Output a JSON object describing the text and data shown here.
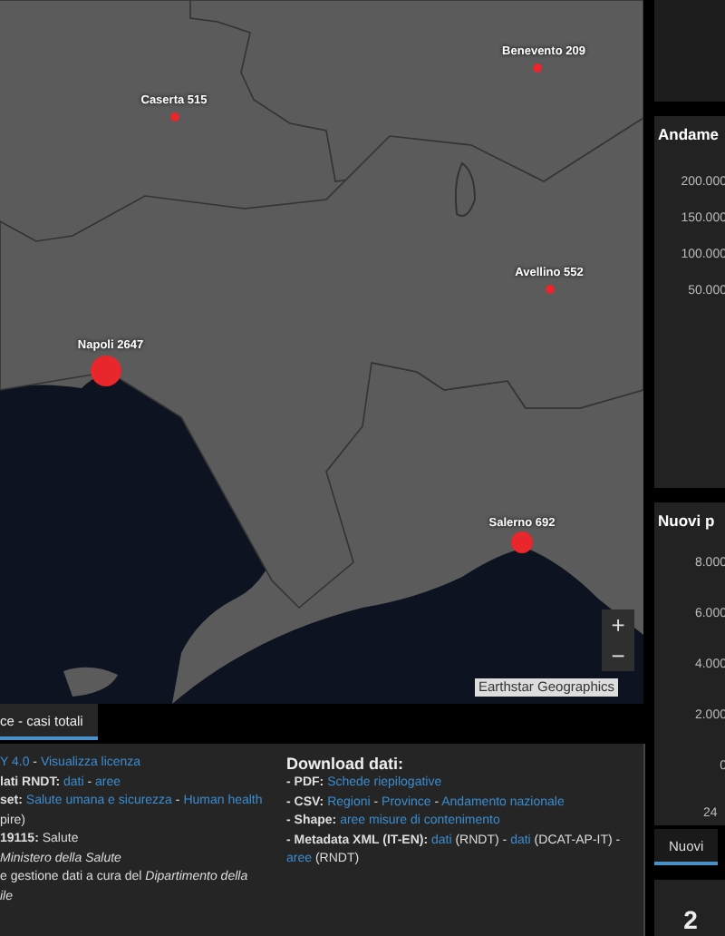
{
  "map": {
    "markers": [
      {
        "label": "Benevento 209",
        "kind": "small"
      },
      {
        "label": "Caserta 515",
        "kind": "small"
      },
      {
        "label": "Avellino 552",
        "kind": "small"
      },
      {
        "label": "Napoli 2647",
        "kind": "large"
      },
      {
        "label": "Salerno 692",
        "kind": "medium"
      }
    ],
    "zoom_in": "+",
    "zoom_out": "−",
    "attribution": "Earthstar Geographics"
  },
  "map_tabs": [
    {
      "label": "ce - casi totali",
      "selected": true
    }
  ],
  "info": {
    "lines": [
      [
        {
          "kind": "link",
          "text": "Y 4.0"
        },
        {
          "kind": "plain",
          "text": " - "
        },
        {
          "kind": "link",
          "text": "Visualizza licenza"
        }
      ],
      [
        {
          "kind": "bold",
          "text": "lati RNDT: "
        },
        {
          "kind": "link",
          "text": "dati"
        },
        {
          "kind": "plain",
          "text": " - "
        },
        {
          "kind": "link",
          "text": "aree"
        }
      ],
      [
        {
          "kind": "bold",
          "text": "set: "
        },
        {
          "kind": "link",
          "text": "Salute umana e sicurezza"
        },
        {
          "kind": "plain",
          "text": " - "
        },
        {
          "kind": "link",
          "text": "Human health"
        }
      ],
      [
        {
          "kind": "plain",
          "text": "pire)"
        }
      ],
      [
        {
          "kind": "bold",
          "text": " 19115: "
        },
        {
          "kind": "plain",
          "text": "Salute"
        }
      ],
      [
        {
          "kind": "italic",
          "text": " Ministero della Salute"
        }
      ],
      [
        {
          "kind": "plain",
          "text": "e gestione dati a cura del "
        },
        {
          "kind": "italic",
          "text": "Dipartimento della"
        }
      ],
      [
        {
          "kind": "italic",
          "text": "ile"
        }
      ]
    ]
  },
  "download": {
    "title": "Download dati:",
    "lines": [
      [
        {
          "kind": "bold",
          "text": "- PDF: "
        },
        {
          "kind": "link",
          "text": "Schede riepilogative"
        }
      ],
      [
        {
          "kind": "bold",
          "text": "- CSV: "
        },
        {
          "kind": "link",
          "text": "Regioni"
        },
        {
          "kind": "plain",
          "text": " - "
        },
        {
          "kind": "link",
          "text": "Province"
        },
        {
          "kind": "plain",
          "text": " - "
        },
        {
          "kind": "link",
          "text": "Andamento nazionale"
        }
      ],
      [
        {
          "kind": "bold",
          "text": "- Shape: "
        },
        {
          "kind": "link",
          "text": "aree misure di contenimento"
        }
      ],
      [
        {
          "kind": "bold",
          "text": "- Metadata XML (IT-EN): "
        },
        {
          "kind": "link",
          "text": "dati"
        },
        {
          "kind": "plain",
          "text": " (RNDT) - "
        },
        {
          "kind": "link",
          "text": "dati"
        },
        {
          "kind": "plain",
          "text": " (DCAT-AP-IT) - "
        },
        {
          "kind": "link",
          "text": "aree"
        },
        {
          "kind": "plain",
          "text": " (RNDT)"
        }
      ]
    ]
  },
  "side": {
    "trend_panel": {
      "title": "Andame",
      "y_ticks": [
        "200.000",
        "150.000",
        "100.000",
        "50.000"
      ]
    },
    "new_panel": {
      "title": "Nuovi p",
      "y_ticks": [
        "8.000",
        "6.000",
        "4.000",
        "2.000",
        "0"
      ],
      "x_tick": "24"
    },
    "new_tabs": [
      {
        "label": "Nuovi",
        "selected": true
      }
    ],
    "bottom_panel": {
      "value": "2"
    }
  }
}
